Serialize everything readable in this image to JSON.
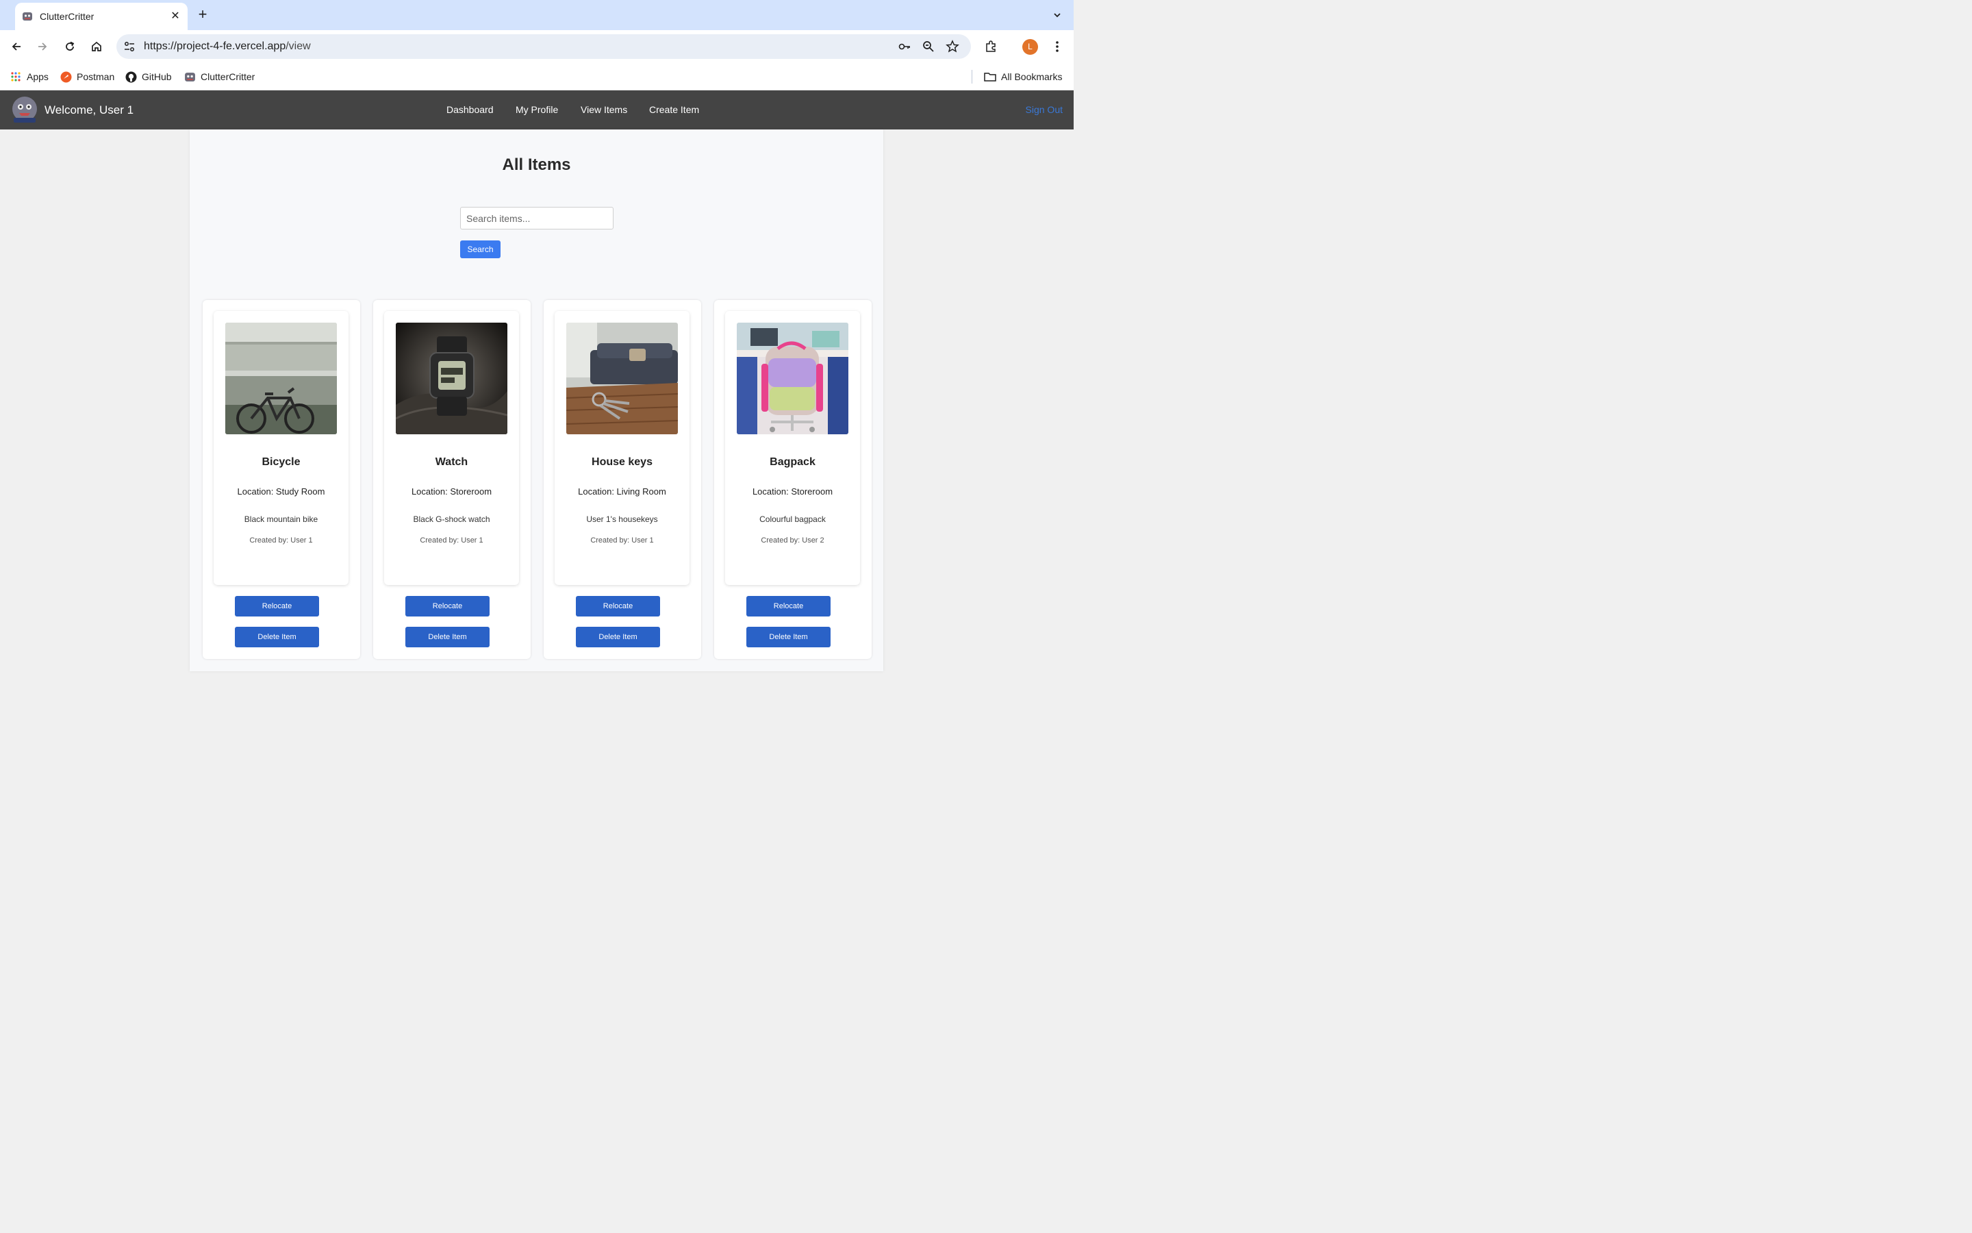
{
  "browser": {
    "tab_title": "ClutterCritter",
    "url_host": "https://project-4-fe.vercel.app",
    "url_path": "/view",
    "avatar_letter": "L",
    "bookmarks": [
      {
        "label": "Apps",
        "icon": "apps-grid-icon"
      },
      {
        "label": "Postman",
        "icon": "postman-icon"
      },
      {
        "label": "GitHub",
        "icon": "github-icon"
      },
      {
        "label": "ClutterCritter",
        "icon": "cluttercritter-icon"
      }
    ],
    "all_bookmarks": "All Bookmarks"
  },
  "navbar": {
    "welcome": "Welcome, User 1",
    "links": [
      "Dashboard",
      "My Profile",
      "View Items",
      "Create Item"
    ],
    "sign_out": "Sign Out"
  },
  "page": {
    "title": "All Items",
    "search_placeholder": "Search items...",
    "search_button": "Search"
  },
  "items": [
    {
      "name": "Bicycle",
      "location": "Location: Study Room",
      "description": "Black mountain bike",
      "created_by": "Created by: User 1",
      "relocate": "Relocate",
      "delete": "Delete Item"
    },
    {
      "name": "Watch",
      "location": "Location: Storeroom",
      "description": "Black G-shock watch",
      "created_by": "Created by: User 1",
      "relocate": "Relocate",
      "delete": "Delete Item"
    },
    {
      "name": "House keys",
      "location": "Location: Living Room",
      "description": "User 1's housekeys",
      "created_by": "Created by: User 1",
      "relocate": "Relocate",
      "delete": "Delete Item"
    },
    {
      "name": "Bagpack",
      "location": "Location: Storeroom",
      "description": "Colourful bagpack",
      "created_by": "Created by: User 2",
      "relocate": "Relocate",
      "delete": "Delete Item"
    }
  ],
  "colors": {
    "tabstrip": "#d3e3fd",
    "navbar": "#444444",
    "primary_button": "#2a62c7",
    "search_button": "#3b7bf0",
    "sign_out": "#3a78d6"
  }
}
